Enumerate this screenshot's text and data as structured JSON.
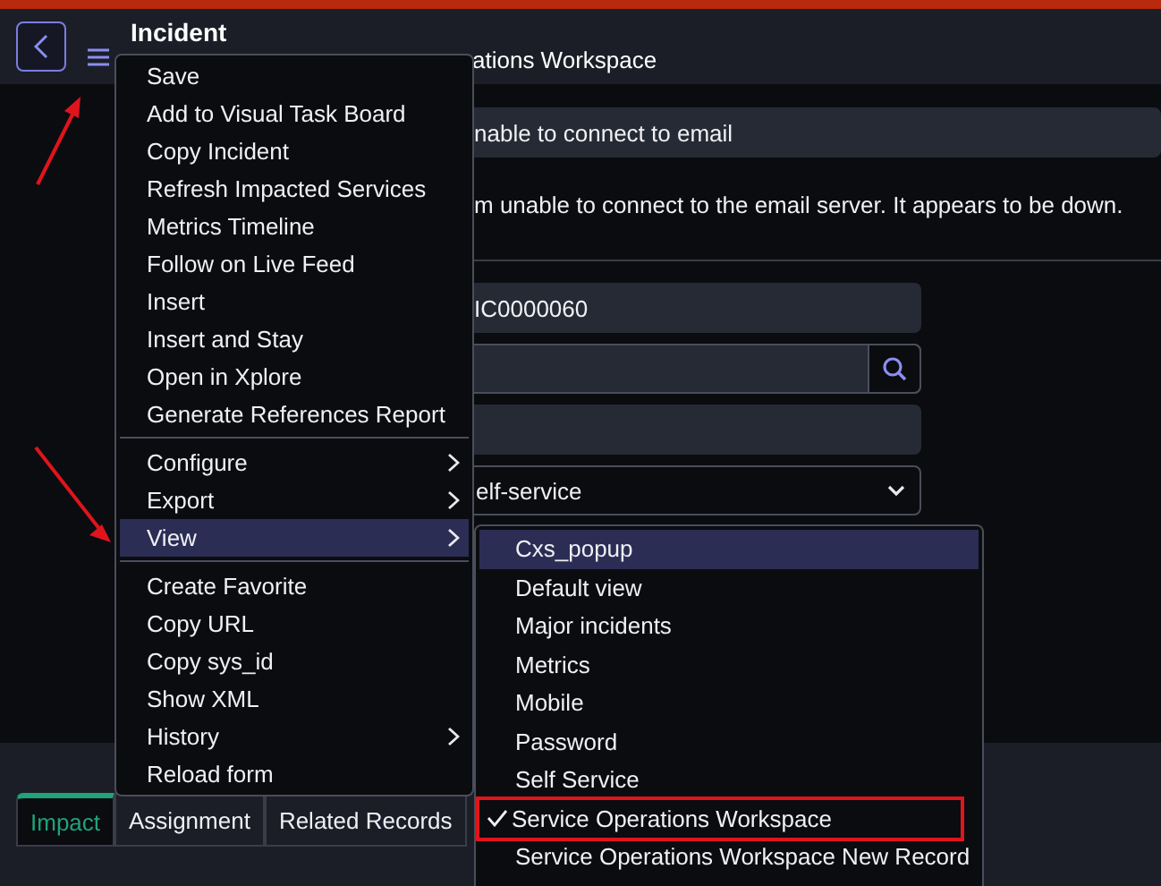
{
  "header": {
    "title": "Incident",
    "subtitle": "ations Workspace"
  },
  "form": {
    "fields": [
      {
        "kind": "text",
        "value": "nable to connect to email"
      },
      {
        "kind": "textarea",
        "value": "m unable to connect to the email server. It appears to be down."
      },
      {
        "kind": "text",
        "value": "IC0000060"
      },
      {
        "kind": "lookup"
      },
      {
        "kind": "text"
      },
      {
        "kind": "select",
        "value": "elf-service"
      }
    ]
  },
  "tabs": [
    {
      "label": "Impact",
      "selected": true
    },
    {
      "label": "Assignment",
      "selected": false
    },
    {
      "label": "Related Records",
      "selected": false
    }
  ],
  "menu": {
    "items": [
      {
        "kind": "item",
        "label": "Save",
        "submenu": false,
        "highlighted": false
      },
      {
        "kind": "item",
        "label": "Add to Visual Task Board",
        "submenu": false,
        "highlighted": false
      },
      {
        "kind": "item",
        "label": "Copy Incident",
        "submenu": false,
        "highlighted": false
      },
      {
        "kind": "item",
        "label": "Refresh Impacted Services",
        "submenu": false,
        "highlighted": false
      },
      {
        "kind": "item",
        "label": "Metrics Timeline",
        "submenu": false,
        "highlighted": false
      },
      {
        "kind": "item",
        "label": "Follow on Live Feed",
        "submenu": false,
        "highlighted": false
      },
      {
        "kind": "item",
        "label": "Insert",
        "submenu": false,
        "highlighted": false
      },
      {
        "kind": "item",
        "label": "Insert and Stay",
        "submenu": false,
        "highlighted": false
      },
      {
        "kind": "item",
        "label": "Open in Xplore",
        "submenu": false,
        "highlighted": false
      },
      {
        "kind": "item",
        "label": "Generate References Report",
        "submenu": false,
        "highlighted": false
      },
      {
        "kind": "separator"
      },
      {
        "kind": "item",
        "label": "Configure",
        "submenu": true,
        "highlighted": false
      },
      {
        "kind": "item",
        "label": "Export",
        "submenu": true,
        "highlighted": false
      },
      {
        "kind": "item",
        "label": "View",
        "submenu": true,
        "highlighted": true
      },
      {
        "kind": "separator"
      },
      {
        "kind": "item",
        "label": "Create Favorite",
        "submenu": false,
        "highlighted": false
      },
      {
        "kind": "item",
        "label": "Copy URL",
        "submenu": false,
        "highlighted": false
      },
      {
        "kind": "item",
        "label": "Copy sys_id",
        "submenu": false,
        "highlighted": false
      },
      {
        "kind": "item",
        "label": "Show XML",
        "submenu": false,
        "highlighted": false
      },
      {
        "kind": "item",
        "label": "History",
        "submenu": true,
        "highlighted": false
      },
      {
        "kind": "item",
        "label": "Reload form",
        "submenu": false,
        "highlighted": false
      }
    ]
  },
  "submenu": {
    "items": [
      {
        "label": "Cxs_popup",
        "highlighted": true,
        "checked": false,
        "outlined": false
      },
      {
        "label": "Default view",
        "highlighted": false,
        "checked": false,
        "outlined": false
      },
      {
        "label": "Major incidents",
        "highlighted": false,
        "checked": false,
        "outlined": false
      },
      {
        "label": "Metrics",
        "highlighted": false,
        "checked": false,
        "outlined": false
      },
      {
        "label": "Mobile",
        "highlighted": false,
        "checked": false,
        "outlined": false
      },
      {
        "label": "Password",
        "highlighted": false,
        "checked": false,
        "outlined": false
      },
      {
        "label": "Self Service",
        "highlighted": false,
        "checked": false,
        "outlined": false
      },
      {
        "label": "Service Operations Workspace",
        "highlighted": false,
        "checked": true,
        "outlined": true
      },
      {
        "label": "Service Operations Workspace New Record",
        "highlighted": false,
        "checked": false,
        "outlined": false
      }
    ]
  }
}
